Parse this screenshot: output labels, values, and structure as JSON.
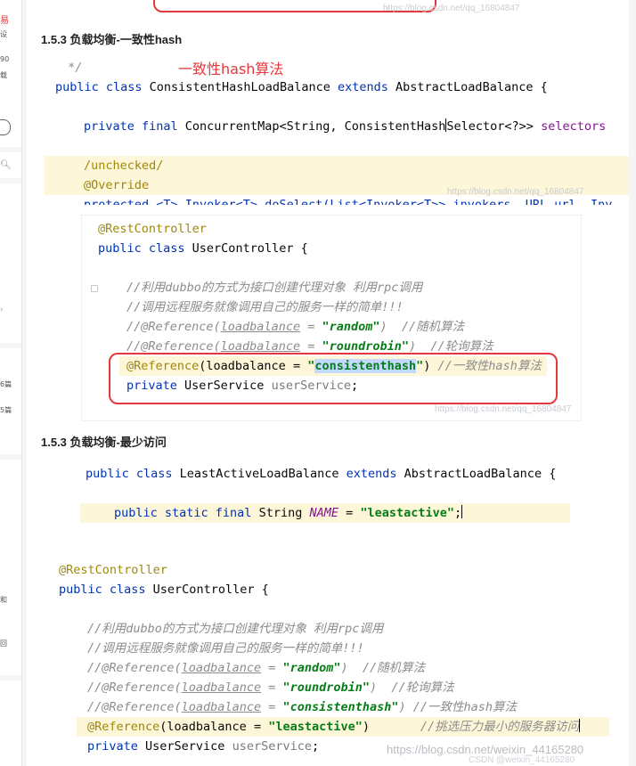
{
  "left_strip": {
    "fragments": [
      {
        "text": "易",
        "red": true
      },
      {
        "text": "设"
      },
      {
        "text": "90"
      },
      {
        "text": "载"
      },
      {
        "text": "6篇"
      },
      {
        "text": "5篇"
      },
      {
        "text": "和"
      },
      {
        "text": "回"
      }
    ]
  },
  "sections": [
    {
      "heading": "1.5.3 负载均衡-一致性hash"
    },
    {
      "heading": "1.5.3 负载均衡-最少访问"
    }
  ],
  "shot1": {
    "annotation": "一致性hash算法",
    "watermark_top": "https://blog.csdn.net/qq_16804847",
    "watermark": "https://blog.csdn.net/qq_16804847",
    "lines": [
      {
        "text": " */"
      },
      {
        "kw1": "public class ",
        "name": "ConsistentHashLoadBalance ",
        "kw2": "extends ",
        "rest": "AbstractLoadBalance {"
      },
      {
        "kw": "private final ",
        "rest": "ConcurrentMap<String, Consistent",
        "caret_after": "Hash",
        "rest2": "Selector<?>> ",
        "field": "selectors"
      },
      {
        "ann": "/unchecked/"
      },
      {
        "ann": "@Override"
      },
      {
        "text": "protected <T> Invoker<T> doSelect(List<Invoker<T>> invokers, URL url, Inv"
      }
    ]
  },
  "shot2": {
    "watermark": "https://blog.csdn.net/qq_16804847",
    "lines": [
      {
        "ann": "@RestController"
      },
      {
        "kw": "public class ",
        "rest": "UserController {"
      },
      {
        "cmt": "//利用dubbo的方式为接口创建代理对象 利用rpc调用"
      },
      {
        "cmt": "//调用远程服务就像调用自己的服务一样的简单!!!"
      },
      {
        "cmt1": "//@Reference(",
        "u": "loadbalance",
        "cmt2": " = ",
        "s": "\"random\"",
        "cmt3": ")  //随机算法"
      },
      {
        "cmt1": "//@Reference(",
        "u": "loadbalance",
        "cmt2": " = ",
        "s": "\"roundrobin\"",
        "cmt3": ")  //轮询算法"
      },
      {
        "ann": "@Reference",
        "rest": "(loadbalance = ",
        "q1": "\"",
        "sel": "consistenthash",
        "q2": "\"",
        "rest2": ") ",
        "cmt": "//一致性hash算法"
      },
      {
        "kw": "private ",
        "rest": "UserService ",
        "grey": "userService",
        "rest2": ";"
      }
    ]
  },
  "shot3": {
    "lines": [
      {
        "kw1": "public class ",
        "name": "LeastActiveLoadBalance ",
        "kw2": "extends ",
        "rest": "AbstractLoadBalance {"
      },
      {
        "kw": "public static final ",
        "rest": "String ",
        "const": "NAME",
        "rest2": " = ",
        "s": "\"leastactive\"",
        "rest3": ";"
      }
    ]
  },
  "shot4": {
    "watermark": "https://blog.csdn.net/weixin_44165280",
    "watermark_under": "CSDN @weixin_44165280",
    "lines": [
      {
        "ann": "@RestController"
      },
      {
        "kw": "public class ",
        "rest": "UserController {"
      },
      {
        "cmt": "//利用dubbo的方式为接口创建代理对象 利用rpc调用"
      },
      {
        "cmt": "//调用远程服务就像调用自己的服务一样的简单!!!"
      },
      {
        "cmt1": "//@Reference(",
        "u": "loadbalance",
        "cmt2": " = ",
        "s": "\"random\"",
        "cmt3": ")  //随机算法"
      },
      {
        "cmt1": "//@Reference(",
        "u": "loadbalance",
        "cmt2": " = ",
        "s": "\"roundrobin\"",
        "cmt3": ")  //轮询算法"
      },
      {
        "cmt1": "//@Reference(",
        "u": "loadbalance",
        "cmt2": " = ",
        "s": "\"consistenthash\"",
        "cmt3": ") //一致性hash算法"
      },
      {
        "ann": "@Reference",
        "rest": "(loadbalance = ",
        "s": "\"leastactive\"",
        "rest2": ")       ",
        "cmt": "//挑选压力最小的服务器访问"
      },
      {
        "kw": "private ",
        "rest": "UserService ",
        "grey": "userService",
        "rest2": ";"
      }
    ]
  }
}
